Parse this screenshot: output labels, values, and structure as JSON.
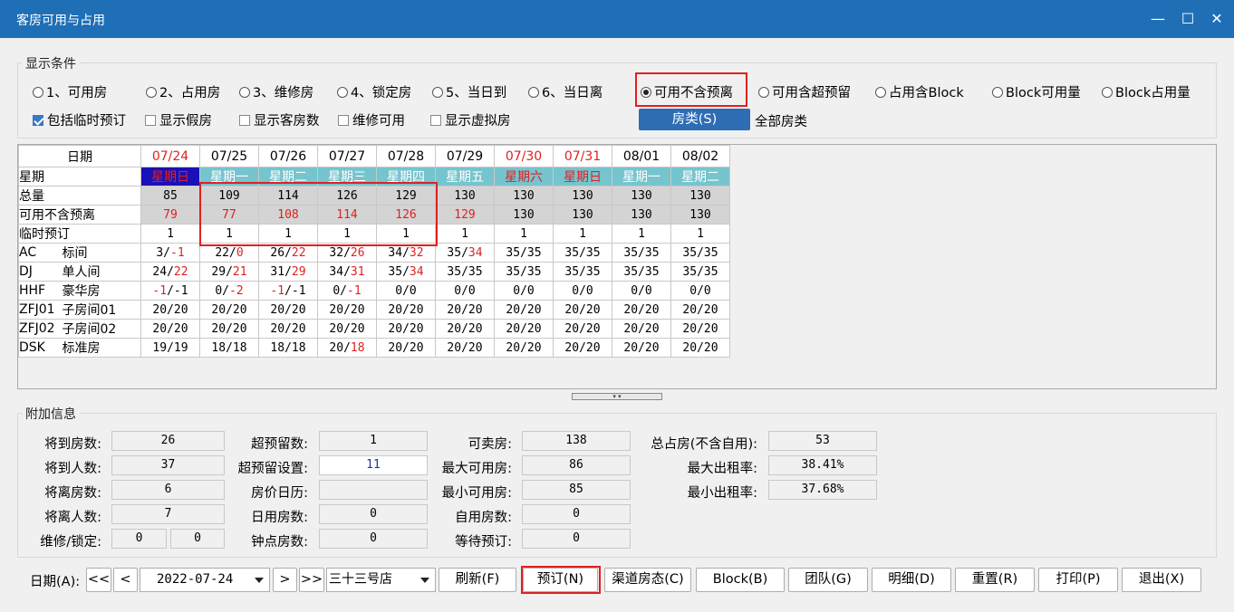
{
  "window": {
    "title": "客房可用与占用"
  },
  "display_conditions": {
    "title": "显示条件",
    "radios": [
      {
        "label": "1、可用房",
        "checked": false
      },
      {
        "label": "2、占用房",
        "checked": false
      },
      {
        "label": "3、维修房",
        "checked": false
      },
      {
        "label": "4、锁定房",
        "checked": false
      },
      {
        "label": "5、当日到",
        "checked": false
      },
      {
        "label": "6、当日离",
        "checked": false
      },
      {
        "label": "可用不含预离",
        "checked": true
      },
      {
        "label": "可用含超预留",
        "checked": false
      },
      {
        "label": "占用含Block",
        "checked": false
      },
      {
        "label": "Block可用量",
        "checked": false
      },
      {
        "label": "Block占用量",
        "checked": false
      }
    ],
    "checks": [
      {
        "label": "包括临时预订",
        "checked": true
      },
      {
        "label": "显示假房",
        "checked": false
      },
      {
        "label": "显示客房数",
        "checked": false
      },
      {
        "label": "维修可用",
        "checked": false
      },
      {
        "label": "显示虚拟房",
        "checked": false
      }
    ],
    "room_type_button": "房类(S)",
    "room_type_value": "全部房类"
  },
  "grid": {
    "date_label": "日期",
    "dates": [
      "07/24",
      "07/25",
      "07/26",
      "07/27",
      "07/28",
      "07/29",
      "07/30",
      "07/31",
      "08/01",
      "08/02"
    ],
    "weekday_label": "星期",
    "weekdays": [
      "星期日",
      "星期一",
      "星期二",
      "星期三",
      "星期四",
      "星期五",
      "星期六",
      "星期日",
      "星期一",
      "星期二"
    ],
    "total_label": "总量",
    "totals": [
      "85",
      "109",
      "114",
      "126",
      "129",
      "130",
      "130",
      "130",
      "130",
      "130"
    ],
    "avail_label": "可用不含预离",
    "avail": [
      "79",
      "77",
      "108",
      "114",
      "126",
      "129",
      "130",
      "130",
      "130",
      "130"
    ],
    "temp_label": "临时预订",
    "temp": [
      "1",
      "1",
      "1",
      "1",
      "1",
      "1",
      "1",
      "1",
      "1",
      "1"
    ],
    "rooms": [
      {
        "code": "AC",
        "name": "标间",
        "values": [
          "3/-1",
          "22/0",
          "26/22",
          "32/26",
          "34/32",
          "35/34",
          "35/35",
          "35/35",
          "35/35",
          "35/35"
        ]
      },
      {
        "code": "DJ",
        "name": "单人间",
        "values": [
          "24/22",
          "29/21",
          "31/29",
          "34/31",
          "35/34",
          "35/35",
          "35/35",
          "35/35",
          "35/35",
          "35/35"
        ]
      },
      {
        "code": "HHF",
        "name": "豪华房",
        "values": [
          "-1/-1",
          "0/-2",
          "-1/-1",
          "0/-1",
          "0/0",
          "0/0",
          "0/0",
          "0/0",
          "0/0",
          "0/0"
        ]
      },
      {
        "code": "ZFJ01",
        "name": "子房间01",
        "values": [
          "20/20",
          "20/20",
          "20/20",
          "20/20",
          "20/20",
          "20/20",
          "20/20",
          "20/20",
          "20/20",
          "20/20"
        ]
      },
      {
        "code": "ZFJ02",
        "name": "子房间02",
        "values": [
          "20/20",
          "20/20",
          "20/20",
          "20/20",
          "20/20",
          "20/20",
          "20/20",
          "20/20",
          "20/20",
          "20/20"
        ]
      },
      {
        "code": "DSK",
        "name": "标准房",
        "values": [
          "19/19",
          "18/18",
          "18/18",
          "20/18",
          "20/20",
          "20/20",
          "20/20",
          "20/20",
          "20/20",
          "20/20"
        ]
      }
    ]
  },
  "extra": {
    "title": "附加信息",
    "arrive_rooms_label": "将到房数:",
    "arrive_rooms": "26",
    "arrive_people_label": "将到人数:",
    "arrive_people": "37",
    "depart_rooms_label": "将离房数:",
    "depart_rooms": "6",
    "depart_people_label": "将离人数:",
    "depart_people": "7",
    "maint_label": "维修/锁定:",
    "maint": "0",
    "locked": "0",
    "overbook_label": "超预留数:",
    "overbook": "1",
    "overbook_set_label": "超预留设置:",
    "overbook_set": "11",
    "price_cal_label": "房价日历:",
    "price_cal": "",
    "dayuse_label": "日用房数:",
    "dayuse": "0",
    "hourly_label": "钟点房数:",
    "hourly": "0",
    "sellable_label": "可卖房:",
    "sellable": "138",
    "max_avail_label": "最大可用房:",
    "max_avail": "86",
    "min_avail_label": "最小可用房:",
    "min_avail": "85",
    "self_use_label": "自用房数:",
    "self_use": "0",
    "waiting_label": "等待预订:",
    "waiting": "0",
    "total_occ_label": "总占房(不含自用):",
    "total_occ": "53",
    "max_occ_label": "最大出租率:",
    "max_occ": "38.41%",
    "min_occ_label": "最小出租率:",
    "min_occ": "37.68%"
  },
  "toolbar": {
    "date_label": "日期(A):",
    "first": "<<",
    "prev": "<",
    "date": "2022-07-24",
    "next": ">",
    "last": ">>",
    "hotel": "三十三号店",
    "refresh": "刷新(F)",
    "reserve": "预订(N)",
    "channel": "渠道房态(C)",
    "block": "Block(B)",
    "group": "团队(G)",
    "detail": "明细(D)",
    "reset": "重置(R)",
    "print": "打印(P)",
    "exit": "退出(X)"
  }
}
